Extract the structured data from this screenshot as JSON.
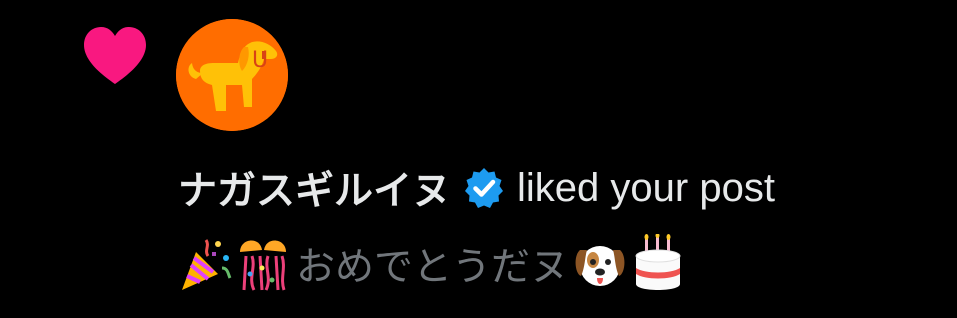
{
  "notification": {
    "type_icon": "heart-icon",
    "avatar": "dog-avatar",
    "user_name": "ナガスギルイヌ",
    "verified_icon": "verified-badge-icon",
    "action": "liked your post",
    "post_preview": {
      "leading_emojis": [
        "party-popper-emoji",
        "confetti-ball-emoji"
      ],
      "text": "おめでとうだヌ",
      "trailing_emojis": [
        "dog-face-emoji",
        "birthday-cake-emoji"
      ]
    }
  },
  "colors": {
    "background": "#000000",
    "heart": "#f91880",
    "primary_text": "#e7e9ea",
    "secondary_text": "#71767b",
    "verified": "#1d9bf0",
    "avatar_bg": "#ff6d00",
    "avatar_dog": "#ffc107"
  }
}
